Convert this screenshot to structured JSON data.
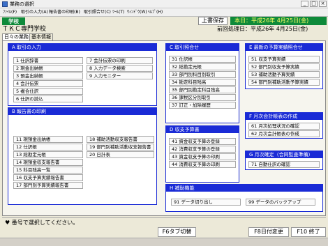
{
  "window": {
    "title": "業務の選択",
    "min": "_",
    "max": "□",
    "close": "×"
  },
  "menu": [
    "ﾌｧｲﾙ(F)",
    "取引の入力(A)",
    "報告書の印刷(B)",
    "取引照合せ(C)",
    "ﾂｰﾙ(T)",
    "ｳｨﾝﾄﾞｳ(W)",
    "ﾍﾙﾌﾟ(H)"
  ],
  "header": {
    "school_chip": "学校",
    "save_label": "上書保存",
    "today": "本日：平成26年 4月25日(金)",
    "school_name": "ＴＫＣ専門学校",
    "prev_date": "前回処理日：平成26年 4月25日(金)"
  },
  "tabs": [
    "日々の業務",
    "基本情報"
  ],
  "groups": {
    "A": {
      "title": "A  取引の入力",
      "items": [
        "1  仕訳辞書",
        "2  現金出納帳",
        "3  預金出納帳",
        "4  会計伝票",
        "5  複合仕訳",
        "6  仕訳の読込",
        "7  会計伝票の印刷",
        "8  入力データ検索",
        "9  入力モニター"
      ]
    },
    "B": {
      "title": "B  報告書の印刷",
      "items": [
        "11  現預金出納帳",
        "12  仕訳帳",
        "13  総勘定元帳",
        "14  現預金収支報告書",
        "15  科目残高一覧",
        "16  収支予算実績報告書",
        "17  部門別予算実績報告書",
        "18  補助活動収支報告書",
        "19  部門別補助活動収支報告書",
        "20  日計表"
      ]
    },
    "C": {
      "title": "C  取引照合せ",
      "items": [
        "31  仕訳帳",
        "32  総勘定元帳",
        "33  部門別科目別取引",
        "34  勘定科目残高",
        "35  部門別勘定科目残高",
        "36  課税区分別取引",
        "37  訂正・加除履歴"
      ]
    },
    "D": {
      "title": "D  収支予算書",
      "items": [
        "41  資金収支予算の登録",
        "42  消費収支予算の登録",
        "43  資金収支予算の印刷",
        "44  消費収支予算の印刷"
      ]
    },
    "E": {
      "title": "E  最新の予算実績照合せ",
      "items": [
        "51  収支予算実績",
        "52  部門別収支予算実績",
        "53  補助活動予算実績",
        "54  部門別補助活動予算実績"
      ]
    },
    "F": {
      "title": "F  月次会計帳表の作成",
      "items": [
        "61  月次処理状況の確認",
        "62  月次会計帳表の作成"
      ]
    },
    "G": {
      "title": "G  月次確定（合同監査準備）",
      "items": [
        "71  自動仕訳の確認"
      ]
    },
    "H": {
      "title": "H  補助機能",
      "items": [
        "91  データ切り出し",
        "99  データのバックアップ"
      ]
    }
  },
  "status": "♥ 番号で選択してください。",
  "fkeys": {
    "f6": "F6タブ切替",
    "f8": "F8日付変更",
    "f10": "F10 終了"
  }
}
